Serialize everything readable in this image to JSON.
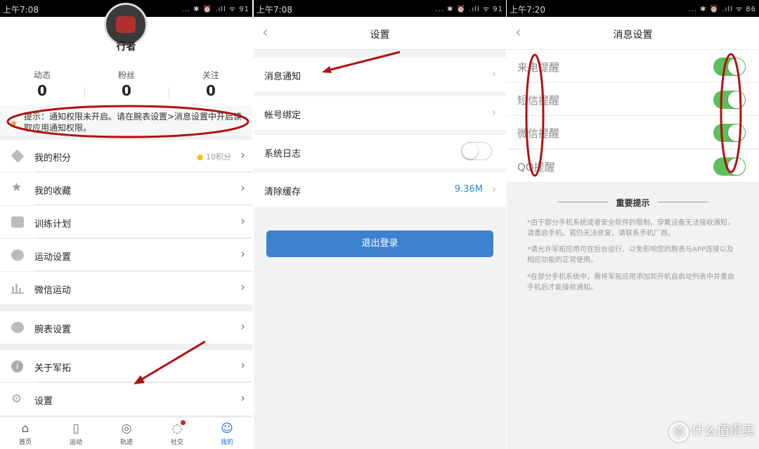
{
  "screen1": {
    "status_time": "上午7:08",
    "status_icons": "... ✱ ⏰ .ıll ᯤ 91",
    "profile": {
      "name": "行者"
    },
    "stats": [
      {
        "label": "动态",
        "value": "0"
      },
      {
        "label": "粉丝",
        "value": "0"
      },
      {
        "label": "关注",
        "value": "0"
      }
    ],
    "tip_text": "提示：通知权限未开启。请在腕表设置>消息设置中开启读取应用通知权限。",
    "menu": [
      {
        "label": "我的积分",
        "icon": "diamond-icon",
        "badge": "10积分"
      },
      {
        "label": "我的收藏",
        "icon": "star-icon"
      },
      {
        "label": "训练计划",
        "icon": "calendar-icon"
      },
      {
        "label": "运动设置",
        "icon": "runner-icon"
      },
      {
        "label": "微信运动",
        "icon": "bar-chart-icon"
      },
      {
        "label": "腕表设置",
        "icon": "watch-icon"
      },
      {
        "label": "关于军拓",
        "icon": "info-icon"
      },
      {
        "label": "设置",
        "icon": "gear-icon"
      }
    ],
    "chevron": "›",
    "tabs": [
      {
        "label": "首页",
        "icon": "home-icon",
        "active": false
      },
      {
        "label": "运动",
        "icon": "bookmark-icon",
        "active": false
      },
      {
        "label": "轨迹",
        "icon": "location-pin-icon",
        "active": false
      },
      {
        "label": "社交",
        "icon": "chat-icon",
        "active": false
      },
      {
        "label": "我的",
        "icon": "user-icon",
        "active": true
      }
    ],
    "accent_color": "#1476d8"
  },
  "screen2": {
    "status_time": "上午7:08",
    "status_icons": "... ✱ ⏰ .ıll ᯤ 91",
    "title": "设置",
    "rows": [
      {
        "label": "消息通知"
      },
      {
        "label": "帐号绑定"
      },
      {
        "label": "系统日志",
        "toggle": "off"
      },
      {
        "label": "清除缓存",
        "value": "9.36M"
      }
    ],
    "logout_label": "退出登录",
    "button_color": "#3d82cf"
  },
  "screen3": {
    "status_time": "上午7:20",
    "status_icons": "... ✱ ⏰ .ıll ᯤ 86",
    "title": "消息设置",
    "rows": [
      {
        "label": "来电提醒",
        "toggle": "on"
      },
      {
        "label": "短信提醒",
        "toggle": "on"
      },
      {
        "label": "微信提醒",
        "toggle": "on"
      },
      {
        "label": "QQ提醒",
        "toggle": "on"
      }
    ],
    "notes_title": "重要提示",
    "notes": [
      "*由于部分手机系统或者安全软件的限制，穿戴设备无法接收通知，请重启手机。若仍无法修复，请联系手机厂商。",
      "*请允许军拓应用可在后台运行，以免影响您的腕表与APP连接以及相应功能的正常使用。",
      "*在部分手机系统中，需将军拓应用添加到开机自启动列表中并重启手机后才能接收通知。"
    ],
    "switch_color": "#5cbf5c",
    "watermark": "什么值得买",
    "watermark_logo": "值"
  },
  "annotation_color": "#b01010"
}
